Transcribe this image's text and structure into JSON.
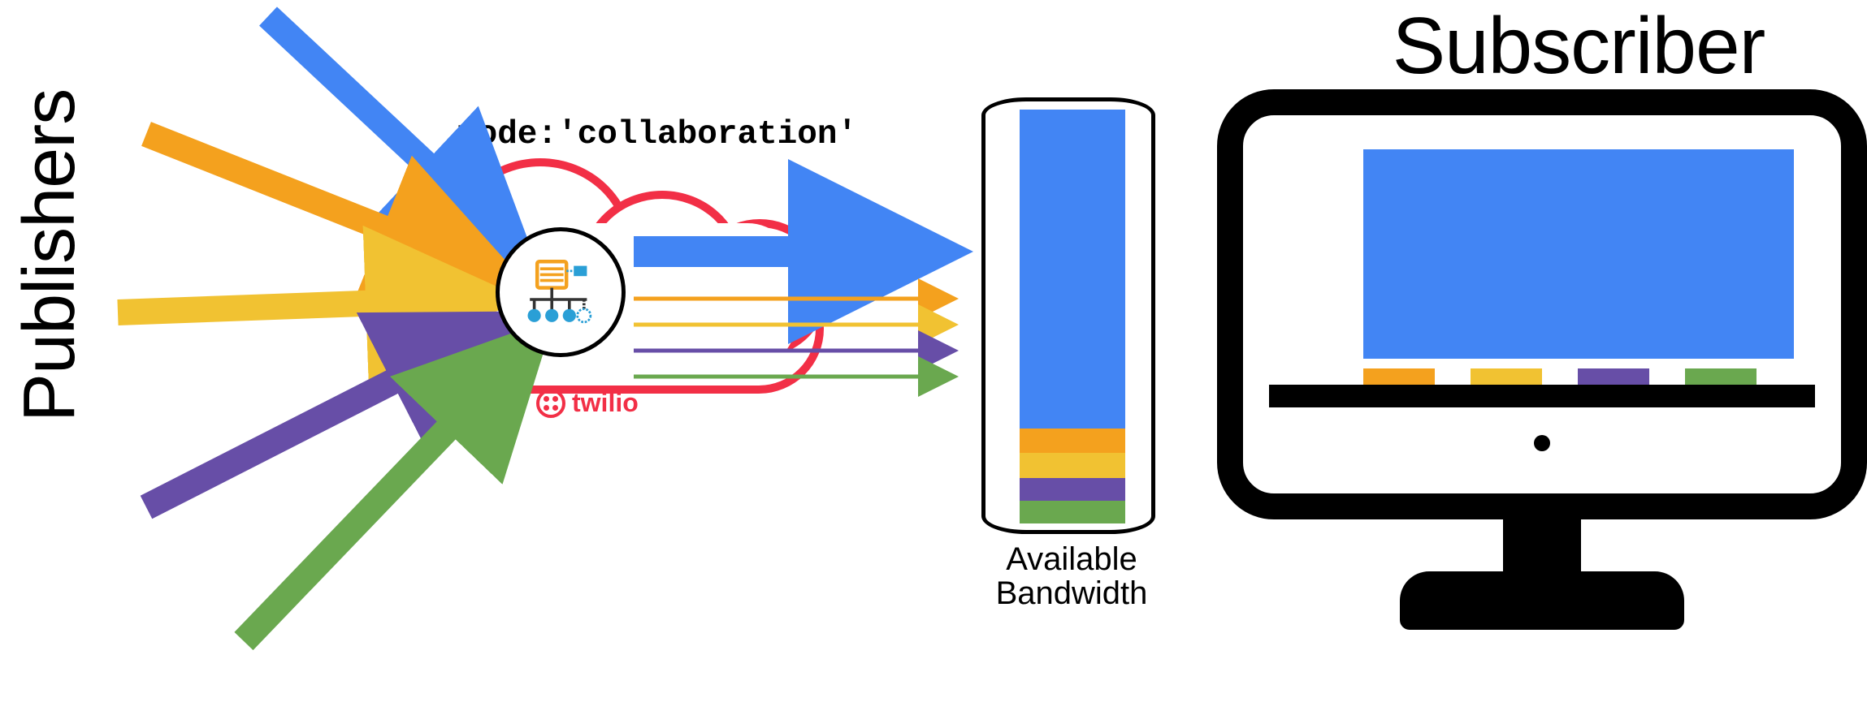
{
  "labels": {
    "publishers": "Publishers",
    "subscriber": "Subscriber",
    "mode": "mode:'collaboration'",
    "bandwidth": "Available Bandwidth",
    "twilio": "twilio"
  },
  "colors": {
    "blue": "#4285f4",
    "orange": "#f4a11e",
    "yellow": "#f1c232",
    "purple": "#674ea7",
    "green": "#6aa84f",
    "red": "#f22f46",
    "black": "#000000"
  },
  "publisher_streams": [
    {
      "id": "blue",
      "color": "blue"
    },
    {
      "id": "orange",
      "color": "orange"
    },
    {
      "id": "yellow",
      "color": "yellow"
    },
    {
      "id": "purple",
      "color": "purple"
    },
    {
      "id": "green",
      "color": "green"
    }
  ],
  "out_streams": [
    {
      "id": "blue",
      "color": "blue",
      "weight": "thick"
    },
    {
      "id": "orange",
      "color": "orange",
      "weight": "thin"
    },
    {
      "id": "yellow",
      "color": "yellow",
      "weight": "thin"
    },
    {
      "id": "purple",
      "color": "purple",
      "weight": "thin"
    },
    {
      "id": "green",
      "color": "green",
      "weight": "thin"
    }
  ],
  "bandwidth_segments": [
    {
      "id": "blue",
      "color": "blue",
      "fraction": 0.77
    },
    {
      "id": "orange",
      "color": "orange",
      "fraction": 0.06
    },
    {
      "id": "yellow",
      "color": "yellow",
      "fraction": 0.06
    },
    {
      "id": "purple",
      "color": "purple",
      "fraction": 0.055
    },
    {
      "id": "green",
      "color": "green",
      "fraction": 0.055
    }
  ],
  "screen": {
    "dominant": {
      "color": "blue"
    },
    "thumbnails": [
      {
        "color": "orange"
      },
      {
        "color": "yellow"
      },
      {
        "color": "purple"
      },
      {
        "color": "green"
      }
    ]
  }
}
